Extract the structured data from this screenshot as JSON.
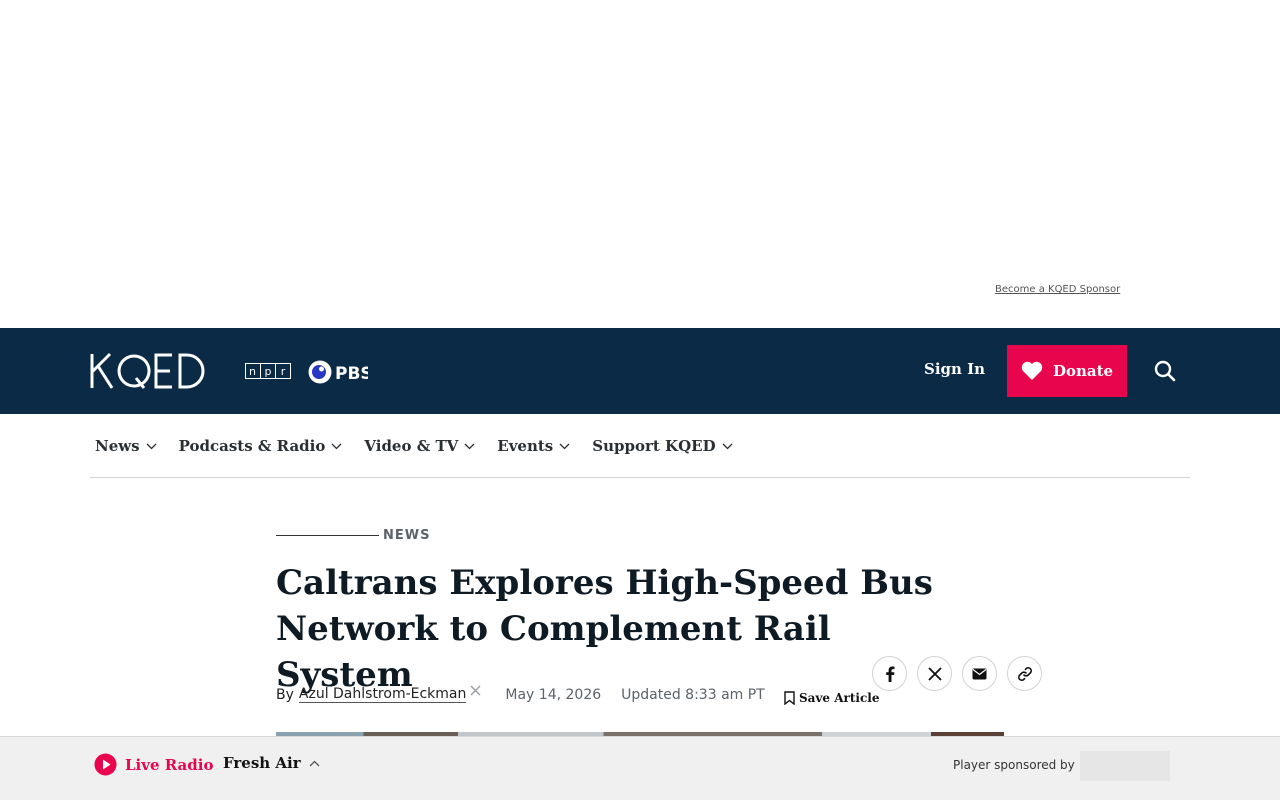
{
  "ad": {
    "sponsor_link": "Become a KQED Sponsor"
  },
  "header": {
    "logo": "KQED",
    "partners": [
      "npr",
      "PBS"
    ],
    "sign_in": "Sign In",
    "donate": "Donate"
  },
  "nav": {
    "items": [
      {
        "label": "News"
      },
      {
        "label": "Podcasts & Radio"
      },
      {
        "label": "Video & TV"
      },
      {
        "label": "Events"
      },
      {
        "label": "Support KQED"
      }
    ]
  },
  "article": {
    "kicker": "NEWS",
    "headline": "Caltrans Explores High-Speed Bus Network to Complement Rail System",
    "by": "By",
    "author": "Azul Dahlstrom-Eckman",
    "date": "May 14, 2026",
    "updated": "Updated 8:33 am PT",
    "save": "Save Article",
    "share_icons": [
      "facebook-icon",
      "x-icon",
      "email-icon",
      "link-icon"
    ]
  },
  "player": {
    "live_label": "Live Radio",
    "show": "Fresh Air",
    "sponsored_by": "Player sponsored by"
  },
  "colors": {
    "brand_dark": "#0a2a45",
    "accent": "#e8054d"
  }
}
